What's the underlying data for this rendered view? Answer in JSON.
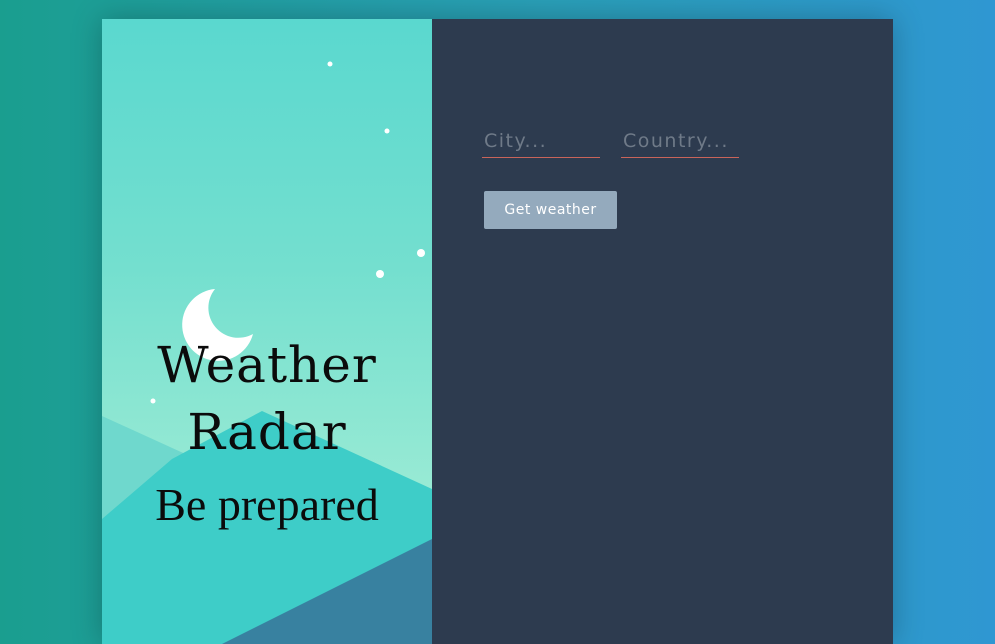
{
  "brand": {
    "title_line1": "Weather",
    "title_line2": "Radar",
    "tagline": "Be prepared"
  },
  "form": {
    "city_placeholder": "City...",
    "country_placeholder": "Country...",
    "city_value": "",
    "country_value": "",
    "submit_label": "Get weather"
  },
  "colors": {
    "background_start": "#1a9e8f",
    "background_end": "#2f97d2",
    "left_panel_top": "#5ad8cf",
    "left_panel_bottom": "#a3eed6",
    "right_panel": "#2d3b4f",
    "field_underline": "#c9645a",
    "button": "#94aabd",
    "moon": "#ffffff"
  },
  "icons": {
    "moon": "moon-icon",
    "stars": "star-icon"
  }
}
